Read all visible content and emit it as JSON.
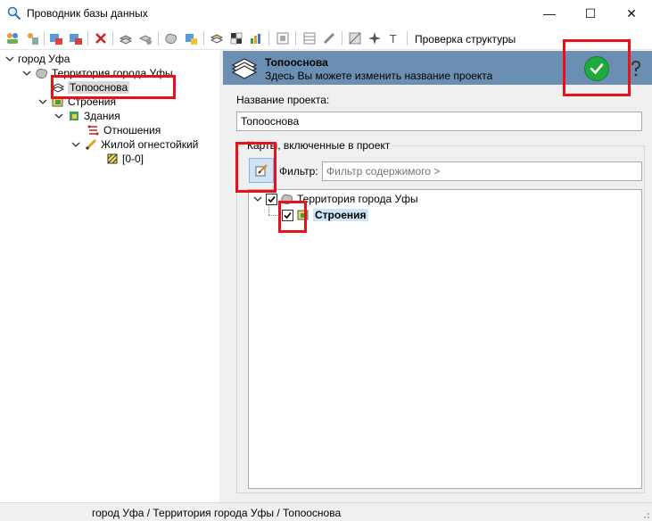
{
  "window": {
    "title": "Проводник базы данных",
    "controls": {
      "minimize": "—",
      "maximize": "☐",
      "close": "✕"
    }
  },
  "toolbar": {
    "check_structure_label": "Проверка структуры"
  },
  "left_tree": {
    "root": "город Уфа",
    "territory": "Территория города Уфы",
    "toposnova": "Топооснова",
    "stroeniya": "Строения",
    "zdaniya": "Здания",
    "otnosheniya": "Отношения",
    "zhiloy": "Жилой огнестойкий",
    "range": "[0-0]"
  },
  "project": {
    "header_title": "Топооснова",
    "header_subtitle": "Здесь Вы можете изменить название проекта",
    "name_label": "Название проекта:",
    "name_value": "Топооснова",
    "maps_group_label": "Карты, включенные в проект",
    "filter_label": "Фильтр:",
    "filter_placeholder": "Фильтр содержимого >",
    "maps": {
      "territory": "Территория города Уфы",
      "stroeniya": "Строения"
    }
  },
  "status": {
    "path": "город Уфа / Территория города Уфы / Топооснова"
  },
  "colors": {
    "header_band": "#6b8fb3",
    "ok_button": "#1faa3c",
    "highlight_red": "#e8101a",
    "selection": "#cce4f7"
  },
  "icons": [
    "app-icon",
    "checkmark-icon",
    "help-icon",
    "edit-icon",
    "layers-icon",
    "folder-icon",
    "chevron-down-icon",
    "checkbox-checked-icon"
  ]
}
